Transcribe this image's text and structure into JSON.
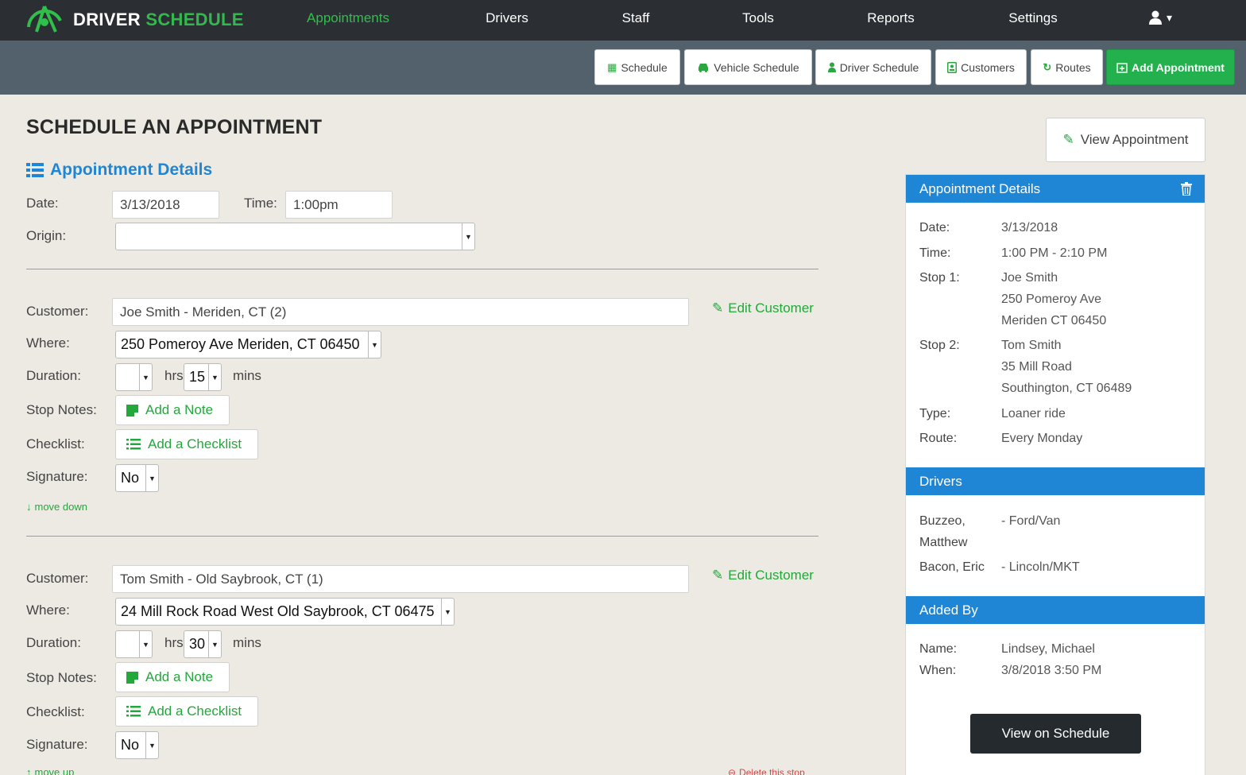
{
  "brand": {
    "word1": "DRIVER",
    "word2": "SCHEDULE"
  },
  "nav": {
    "items": [
      {
        "label": "Appointments",
        "active": true
      },
      {
        "label": "Drivers"
      },
      {
        "label": "Staff"
      },
      {
        "label": "Tools"
      },
      {
        "label": "Reports"
      },
      {
        "label": "Settings"
      }
    ],
    "user_icon": "user-icon",
    "user_caret": "▾"
  },
  "toolbar": {
    "buttons": [
      {
        "label": "Schedule",
        "icon": "calendar-icon"
      },
      {
        "label": "Vehicle Schedule",
        "icon": "car-icon"
      },
      {
        "label": "Driver Schedule",
        "icon": "user-icon"
      },
      {
        "label": "Customers",
        "icon": "contact-icon"
      },
      {
        "label": "Routes",
        "icon": "refresh-icon"
      },
      {
        "label": "Add Appointment",
        "icon": "calendar-plus-icon"
      }
    ]
  },
  "page": {
    "title": "SCHEDULE AN APPOINTMENT",
    "section_title": "Appointment Details",
    "date_label": "Date:",
    "date_value": "3/13/2018",
    "time_label": "Time:",
    "time_value": "1:00pm",
    "origin_label": "Origin:",
    "origin_value": ""
  },
  "labels": {
    "customer": "Customer:",
    "where": "Where:",
    "duration": "Duration:",
    "hrs": "hrs",
    "mins": "mins",
    "stop_notes": "Stop Notes:",
    "checklist": "Checklist:",
    "signature": "Signature:",
    "edit_customer": "Edit Customer",
    "add_note": "Add a Note",
    "add_checklist": "Add a Checklist"
  },
  "stops": [
    {
      "customer": "Joe Smith - Meriden, CT (2)",
      "where": "250 Pomeroy Ave Meriden, CT 06450",
      "hours": "",
      "minutes": "15",
      "signature": "No",
      "move_link": "move down"
    },
    {
      "customer": "Tom Smith - Old Saybrook, CT (1)",
      "where": "24 Mill Rock Road West Old Saybrook, CT 06475",
      "hours": "",
      "minutes": "30",
      "signature": "No",
      "move_link": "move up",
      "delete_link": "Delete this stop"
    }
  ],
  "sidebar": {
    "view_button": "View Appointment",
    "details_header": "Appointment Details",
    "details": {
      "date_k": "Date:",
      "date_v": "3/13/2018",
      "time_k": "Time:",
      "time_v": "1:00 PM - 2:10 PM",
      "stop1_k": "Stop 1:",
      "stop1_v": [
        "Joe Smith",
        "250 Pomeroy Ave",
        "Meriden CT 06450"
      ],
      "stop2_k": "Stop 2:",
      "stop2_v": [
        "Tom Smith",
        "35 Mill Road",
        "Southington, CT 06489"
      ],
      "type_k": "Type:",
      "type_v": "Loaner ride",
      "route_k": "Route:",
      "route_v": "Every Monday"
    },
    "drivers_header": "Drivers",
    "drivers": [
      {
        "name": [
          "Buzzeo,",
          "Matthew"
        ],
        "vehicle": "- Ford/Van"
      },
      {
        "name": [
          "Bacon, Eric"
        ],
        "vehicle": "- Lincoln/MKT"
      }
    ],
    "added_header": "Added By",
    "added": {
      "name_k": "Name:",
      "name_v": "Lindsey, Michael",
      "when_k": "When:",
      "when_v": "3/8/2018 3:50 PM"
    },
    "schedule_button": "View on Schedule"
  },
  "colors": {
    "nav_bg": "#2b2f33",
    "toolbar_bg": "#53616d",
    "accent_green": "#22b14c",
    "accent_blue": "#1f86d6",
    "page_bg": "#edeae3"
  }
}
